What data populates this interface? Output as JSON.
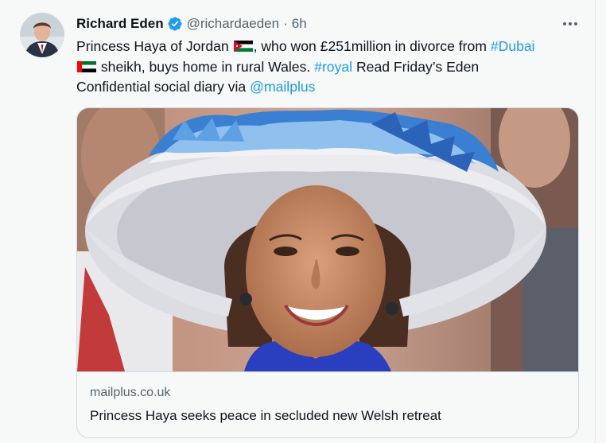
{
  "author": {
    "name": "Richard Eden",
    "handle": "@richardaeden",
    "separator": "·",
    "time": "6h",
    "verified_icon": "verified-badge-icon"
  },
  "tweet": {
    "segments": {
      "s1": "Princess Haya of Jordan ",
      "s2": ", who won £251million in divorce from ",
      "hashtag_dubai": "#Dubai",
      "s3": " sheikh, buys home in rural Wales. ",
      "hashtag_royal": "#royal",
      "s4": " Read Friday’s Eden",
      "s5": "Confidential social diary via ",
      "mention_mailplus": "@mailplus"
    },
    "emoji": [
      "jordan-flag",
      "uae-flag"
    ]
  },
  "link_card": {
    "domain": "mailplus.co.uk",
    "title": "Princess Haya seeks peace in secluded new Welsh retreat"
  },
  "colors": {
    "link": "#1d9bf0",
    "text": "#0f1419",
    "secondary": "#536471",
    "background": "#f7f9f9",
    "border": "#cfd9de",
    "verified": "#1d9bf0"
  }
}
